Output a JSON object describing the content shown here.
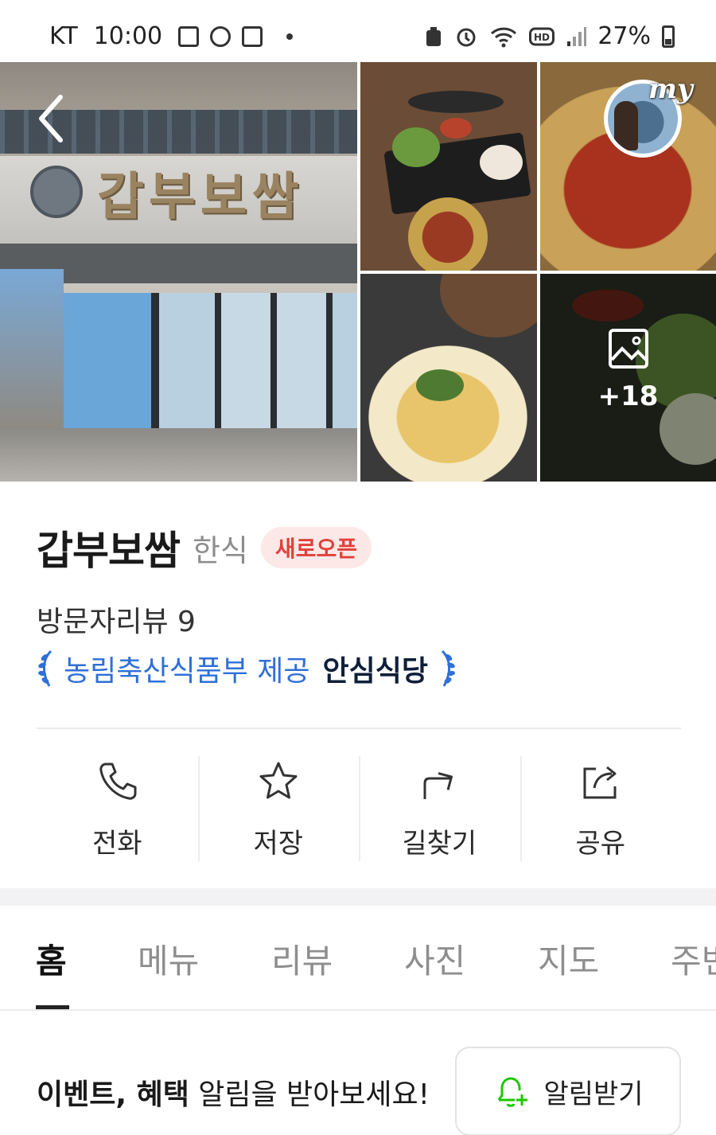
{
  "status_bar": {
    "carrier": "KT",
    "time": "10:00",
    "left_icons": [
      "gallery-icon",
      "shield-hex-icon",
      "naver-calendar-icon",
      "dot-icon"
    ],
    "right_icons": [
      "battery-lock-icon",
      "alarm-icon",
      "wifi-icon",
      "hd-icon",
      "signal-icon"
    ],
    "battery": "27%"
  },
  "photos": {
    "my_label": "my",
    "more_count": "+18"
  },
  "place": {
    "name": "갑부보쌈",
    "category": "한식",
    "badge": "새로오픈",
    "badge_color": "#e0413b",
    "visitor_reviews": "방문자리뷰 9",
    "safe_provider": "농림축산식품부 제공",
    "safe_name": "안심식당"
  },
  "actions": [
    {
      "label": "전화",
      "icon": "phone-icon"
    },
    {
      "label": "저장",
      "icon": "star-icon"
    },
    {
      "label": "길찾기",
      "icon": "directions-icon"
    },
    {
      "label": "공유",
      "icon": "share-icon"
    }
  ],
  "tabs": [
    {
      "label": "홈",
      "active": true
    },
    {
      "label": "메뉴",
      "active": false
    },
    {
      "label": "리뷰",
      "active": false
    },
    {
      "label": "사진",
      "active": false
    },
    {
      "label": "지도",
      "active": false
    },
    {
      "label": "주변",
      "active": false
    }
  ],
  "notify": {
    "text_bold": "이벤트, 혜택",
    "text_rest": " 알림을 받아보세요!",
    "button_label": "알림받기",
    "accent": "#1ec800"
  },
  "colors": {
    "link_blue": "#2f6fd8",
    "badge_bg": "#fde8e8"
  }
}
